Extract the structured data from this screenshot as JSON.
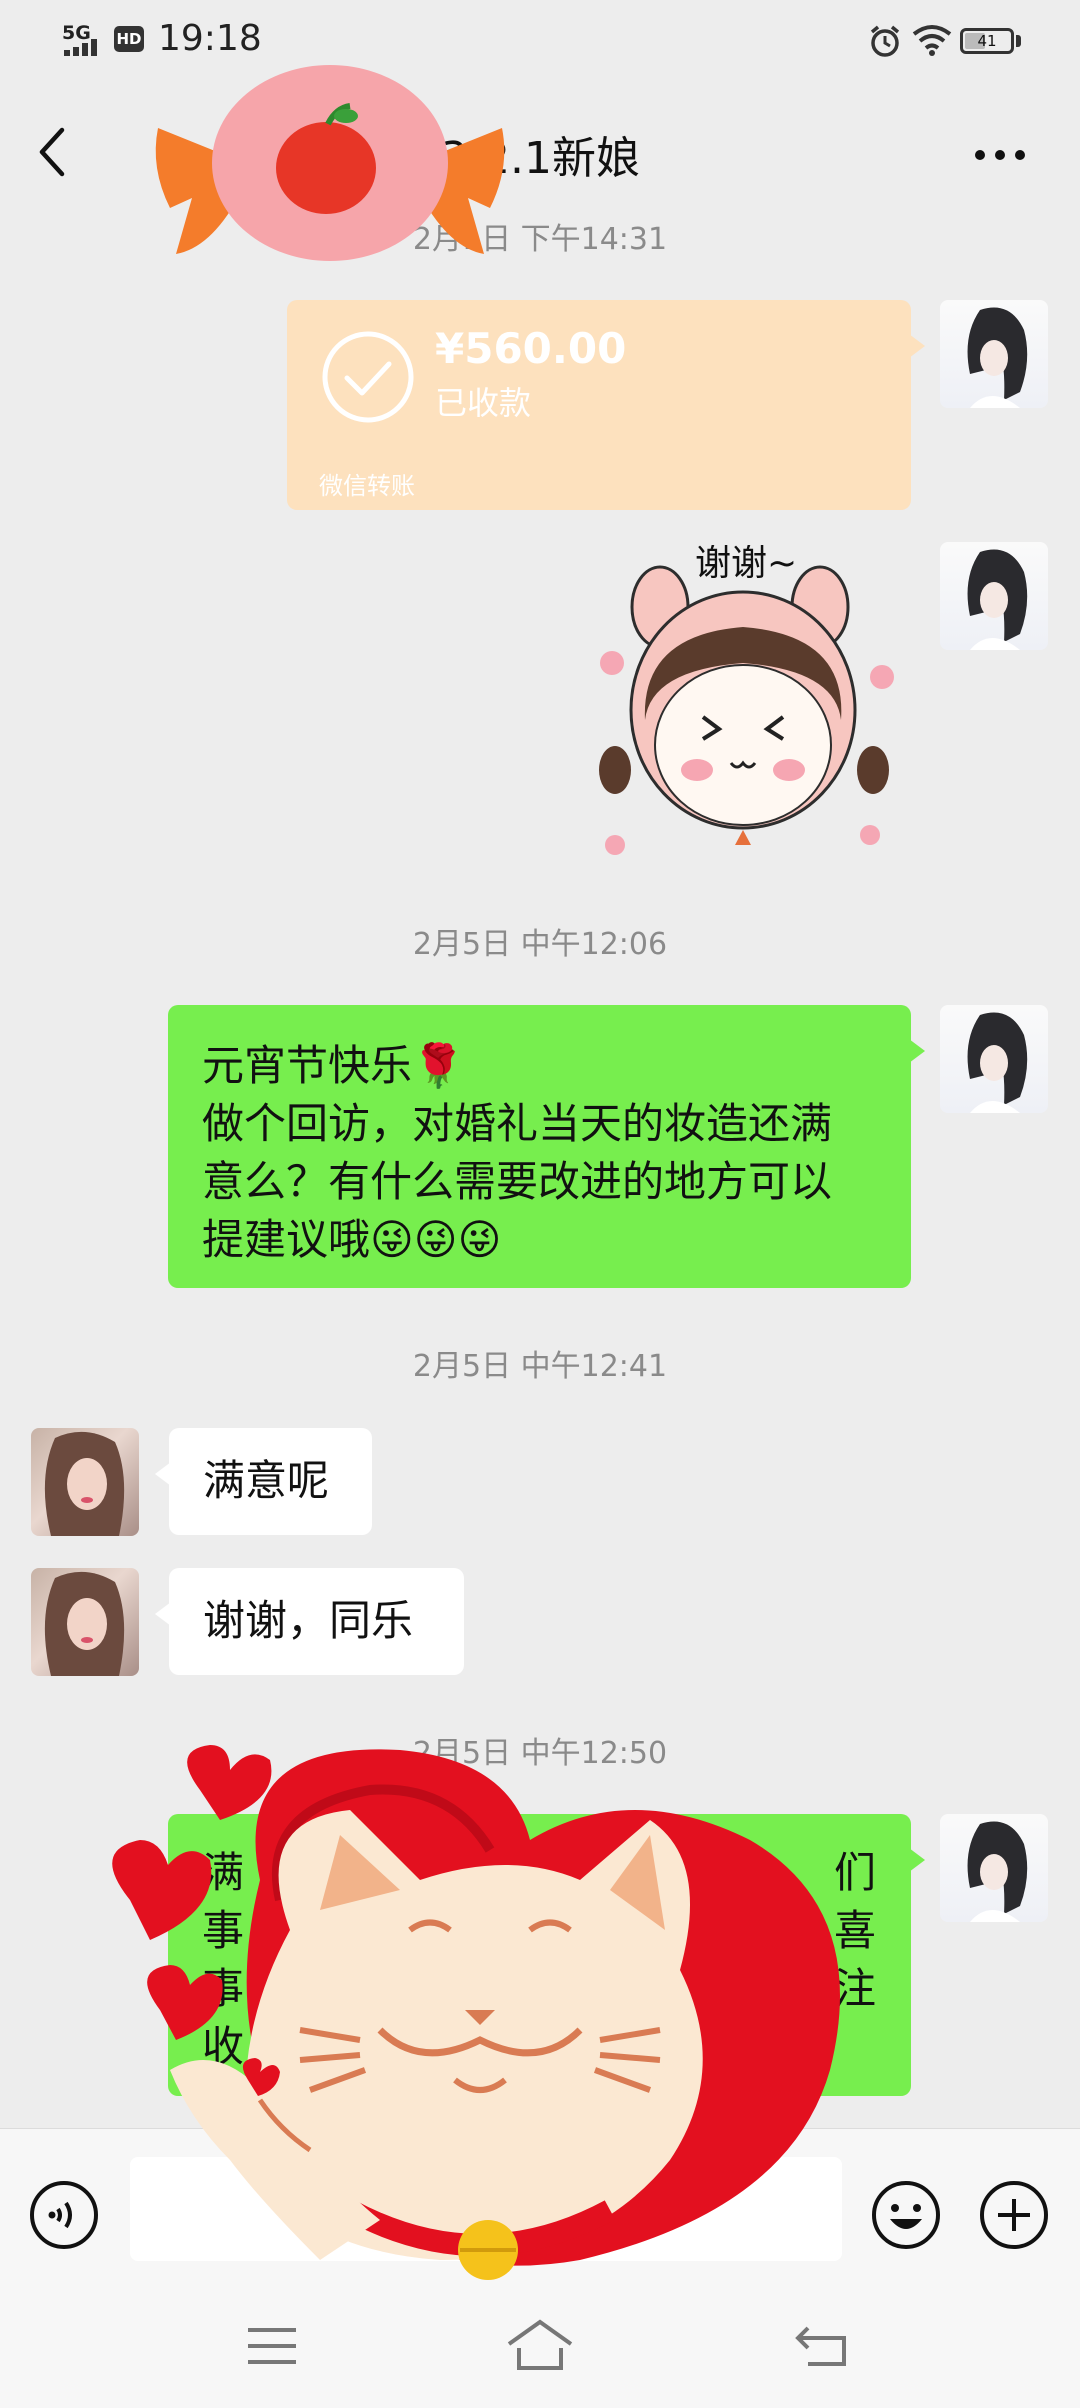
{
  "status_bar": {
    "network": "5G",
    "hd": "HD",
    "time": "19:18",
    "battery": "41",
    "battery_level_percent": 41
  },
  "header": {
    "title": "3.2.1新娘",
    "back_icon": "chevron-left-icon",
    "more_icon": "more-dots-icon"
  },
  "messages": {
    "ts1": "2月1日 下午14:31",
    "transfer": {
      "amount": "¥560.00",
      "status": "已收款",
      "footer": "微信转账"
    },
    "sticker_text": "谢谢~",
    "ts2": "2月5日 中午12:06",
    "msg_greeting": {
      "line1": "元宵节快乐🌹",
      "line2": "做个回访，对婚礼当天的妆造还满",
      "line3": "意么？有什么需要改进的地方可以",
      "line4": "提建议哦😜😜😜"
    },
    "ts3": "2月5日 中午12:41",
    "reply1": "满意呢",
    "reply2": "谢谢，同乐",
    "ts4": "2月5日 中午12:50",
    "partial": {
      "l1_start": "满",
      "l1_end": "们",
      "l2_start": "事",
      "l2_end": "喜",
      "l3_start": "事",
      "l3_end": "注",
      "l4_start": "收"
    }
  },
  "input_bar": {
    "placeholder": "",
    "voice_icon": "voice-icon",
    "emoji_icon": "smiley-icon",
    "add_icon": "plus-circle-icon"
  },
  "nav_bar": {
    "icons": [
      "menu-icon",
      "home-icon",
      "back-icon"
    ]
  },
  "colors": {
    "background": "#ededed",
    "my_bubble": "#77ee4e",
    "their_bubble": "#ffffff",
    "transfer_card": "#fde1be",
    "heart_red": "#e3101f"
  }
}
